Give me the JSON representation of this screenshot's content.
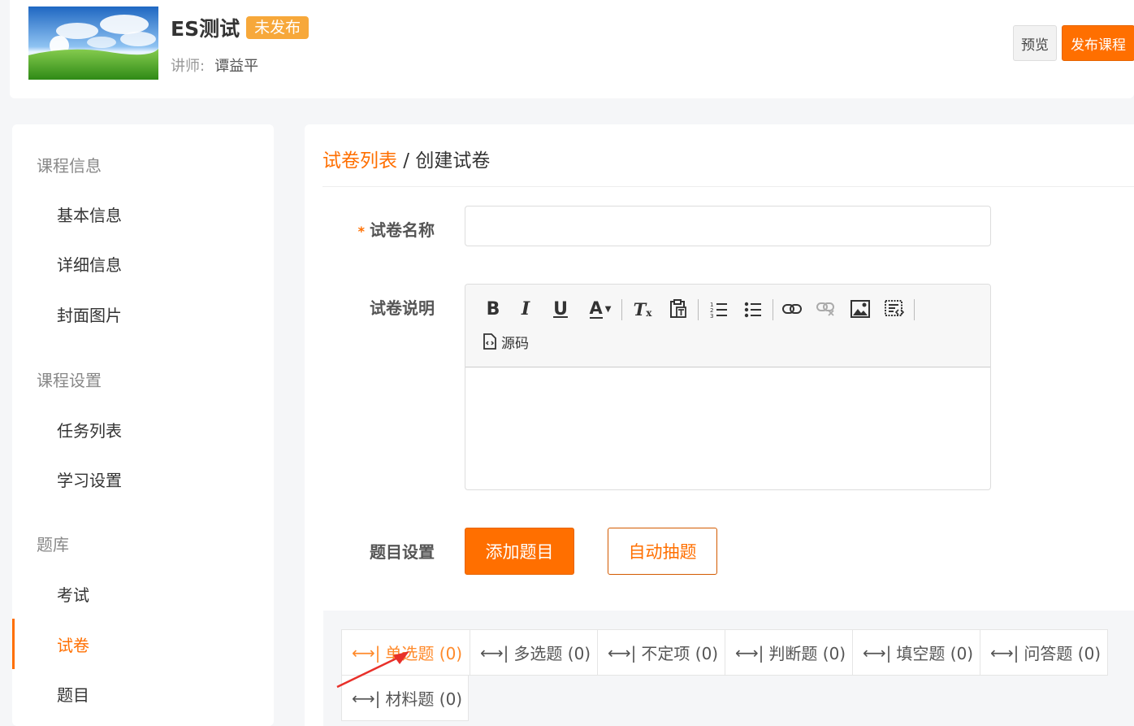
{
  "header": {
    "course_title": "ES测试",
    "status_badge": "未发布",
    "teacher_label": "讲师:",
    "teacher_name": "谭益平",
    "preview_label": "预览",
    "publish_label": "发布课程"
  },
  "sidebar": {
    "groups": [
      {
        "title": "课程信息",
        "items": [
          "基本信息",
          "详细信息",
          "封面图片"
        ]
      },
      {
        "title": "课程设置",
        "items": [
          "任务列表",
          "学习设置"
        ]
      },
      {
        "title": "题库",
        "items": [
          "考试",
          "试卷",
          "题目"
        ]
      }
    ],
    "active_item": "试卷"
  },
  "breadcrumb": {
    "link": "试卷列表",
    "separator": " / ",
    "current": "创建试卷"
  },
  "form": {
    "required_mark": "*",
    "name_label": "试卷名称",
    "name_value": "",
    "desc_label": "试卷说明",
    "source_label": "源码",
    "question_label": "题目设置",
    "add_button": "添加题目",
    "auto_button": "自动抽题"
  },
  "question_types": [
    {
      "label": "单选题 (0)",
      "active": true
    },
    {
      "label": "多选题 (0)",
      "active": false
    },
    {
      "label": "不定项 (0)",
      "active": false
    },
    {
      "label": "判断题 (0)",
      "active": false
    },
    {
      "label": "填空题 (0)",
      "active": false
    },
    {
      "label": "问答题 (0)",
      "active": false
    },
    {
      "label": "材料题 (0)",
      "active": false
    }
  ],
  "colors": {
    "accent": "#ff6f00",
    "badge": "#f7a83a",
    "annotation_arrow": "#e8302a"
  }
}
